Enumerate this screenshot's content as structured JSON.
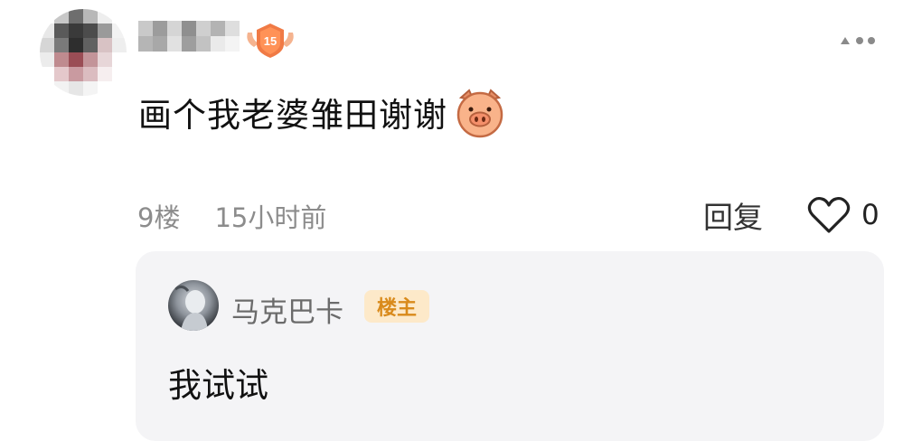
{
  "post": {
    "level": "15",
    "content": "画个我老婆雏田谢谢",
    "emoji": "pig-face-emoji"
  },
  "meta": {
    "floor": "9楼",
    "time": "15小时前"
  },
  "actions": {
    "reply_label": "回复",
    "like_count": "0"
  },
  "reply": {
    "author": "马克巴卡",
    "badge": "楼主",
    "content": "我试试"
  },
  "colors": {
    "badge_bg": "#fde9c9",
    "badge_text": "#d98a1b",
    "level_badge": "#f07a45",
    "reply_bg": "#f4f4f6",
    "meta_text": "#8c8c8c"
  },
  "icons": [
    "more-icon",
    "heart-icon",
    "level-badge-icon",
    "pig-emoji-icon"
  ]
}
